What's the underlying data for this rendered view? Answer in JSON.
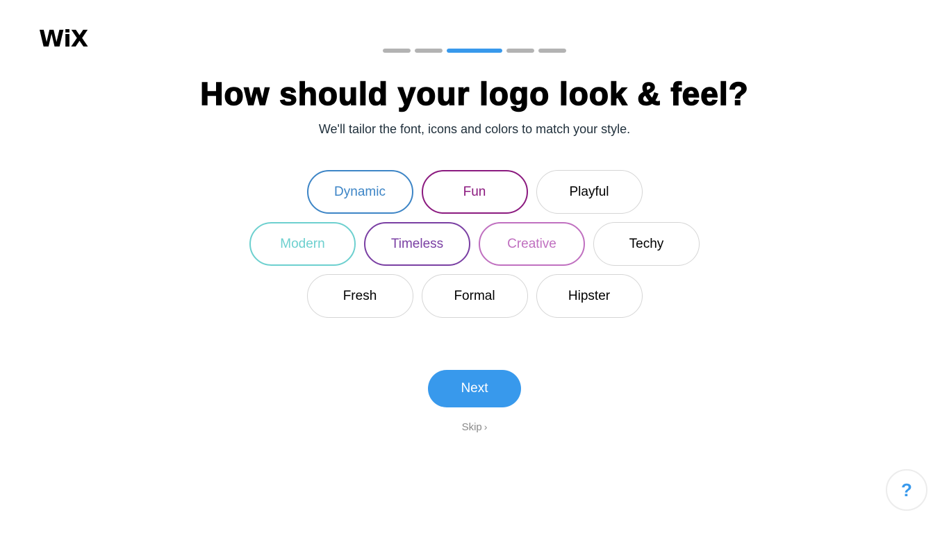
{
  "brand": {
    "logo_text": "WiX"
  },
  "progress": {
    "total_steps": 5,
    "current_step": 3
  },
  "header": {
    "title": "How should your logo look & feel?",
    "subtitle": "We'll tailor the font, icons and colors to match your style."
  },
  "styles": [
    {
      "label": "Dynamic",
      "selected": true,
      "color": "#3d85c6"
    },
    {
      "label": "Fun",
      "selected": true,
      "color": "#8b1a7f"
    },
    {
      "label": "Playful",
      "selected": false,
      "color": "#000000"
    },
    {
      "label": "Modern",
      "selected": true,
      "color": "#6dd0cf"
    },
    {
      "label": "Timeless",
      "selected": true,
      "color": "#7a3fa3"
    },
    {
      "label": "Creative",
      "selected": true,
      "color": "#c070c0"
    },
    {
      "label": "Techy",
      "selected": false,
      "color": "#000000"
    },
    {
      "label": "Fresh",
      "selected": false,
      "color": "#000000"
    },
    {
      "label": "Formal",
      "selected": false,
      "color": "#000000"
    },
    {
      "label": "Hipster",
      "selected": false,
      "color": "#000000"
    }
  ],
  "actions": {
    "next_label": "Next",
    "skip_label": "Skip",
    "skip_icon": "chevron-right-icon",
    "help_label": "?"
  },
  "colors": {
    "accent": "#3899ec",
    "inactive_step": "#b3b3b3",
    "unselected_border": "#d5d5d5"
  }
}
